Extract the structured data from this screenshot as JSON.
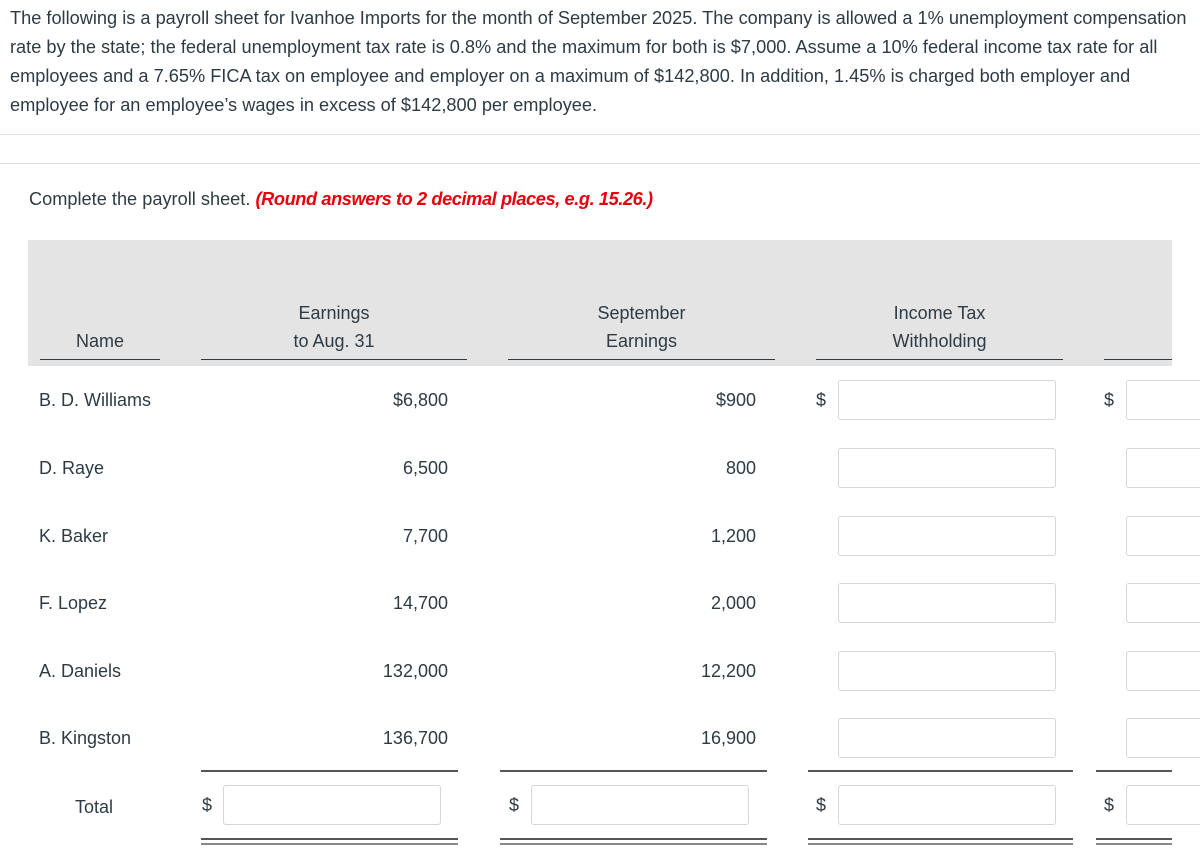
{
  "problem": {
    "text": "The following is a payroll sheet for Ivanhoe Imports for the month of September 2025. The company is allowed a 1% unemployment compensation rate by the state; the federal unemployment tax rate is 0.8% and the maximum for both is $7,000. Assume a 10% federal income tax rate for all employees and a 7.65% FICA tax on employee and employer on a maximum of $142,800. In addition, 1.45% is charged both employer and employee for an employee’s wages in excess of $142,800 per employee."
  },
  "instructions": {
    "text": "Complete the payroll sheet.",
    "note": "(Round answers to 2 decimal places, e.g. 15.26.)"
  },
  "table": {
    "headers": {
      "name": "Name",
      "earnings_to_aug": [
        "Earnings",
        "to Aug. 31"
      ],
      "september_earnings": [
        "September",
        "Earnings"
      ],
      "income_tax": [
        "Income Tax",
        "Withholding"
      ]
    },
    "currency_symbol": "$",
    "rows": [
      {
        "name": "B. D. Williams",
        "earnings_to_aug": "$6,800",
        "september_earnings": "$900",
        "income_tax_value": "",
        "next_col_value": ""
      },
      {
        "name": "D. Raye",
        "earnings_to_aug": "6,500",
        "september_earnings": "800",
        "income_tax_value": "",
        "next_col_value": ""
      },
      {
        "name": "K. Baker",
        "earnings_to_aug": "7,700",
        "september_earnings": "1,200",
        "income_tax_value": "",
        "next_col_value": ""
      },
      {
        "name": "F. Lopez",
        "earnings_to_aug": "14,700",
        "september_earnings": "2,000",
        "income_tax_value": "",
        "next_col_value": ""
      },
      {
        "name": "A. Daniels",
        "earnings_to_aug": "132,000",
        "september_earnings": "12,200",
        "income_tax_value": "",
        "next_col_value": ""
      },
      {
        "name": "B. Kingston",
        "earnings_to_aug": "136,700",
        "september_earnings": "16,900",
        "income_tax_value": "",
        "next_col_value": ""
      }
    ],
    "total": {
      "label": "Total",
      "earnings_to_aug_value": "",
      "september_earnings_value": "",
      "income_tax_value": "",
      "next_col_value": ""
    }
  }
}
